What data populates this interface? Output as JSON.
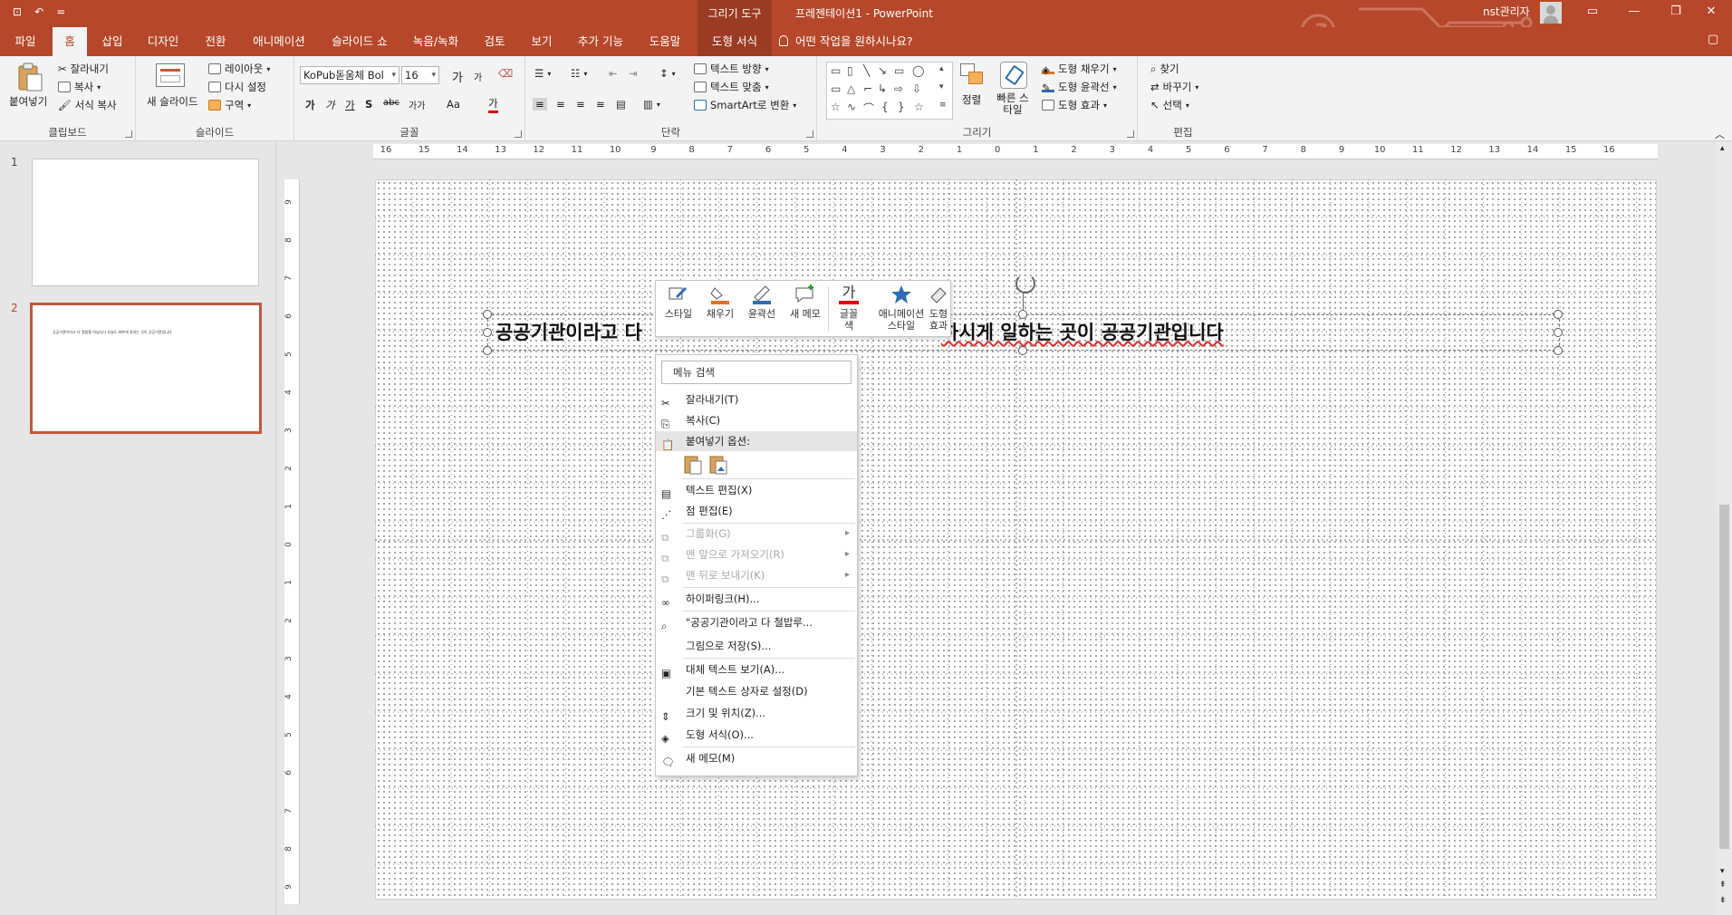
{
  "titlebar": {
    "qat_save": "𝟛",
    "qat_undo": "⟲",
    "qat_more": "≂",
    "tools_tab": "그리기 도구",
    "title": "프레젠테이션1  -  PowerPoint",
    "user": "nst관리자",
    "ribbon_display": "▣",
    "minimize": "—",
    "restore": "❐",
    "close": "✕"
  },
  "tabs": [
    {
      "label": "파일"
    },
    {
      "label": "홈"
    },
    {
      "label": "삽입"
    },
    {
      "label": "디자인"
    },
    {
      "label": "전환"
    },
    {
      "label": "애니메이션"
    },
    {
      "label": "슬라이드 쇼"
    },
    {
      "label": "녹음/녹화"
    },
    {
      "label": "검토"
    },
    {
      "label": "보기"
    },
    {
      "label": "추가 기능"
    },
    {
      "label": "도움말"
    },
    {
      "label": "도형 서식"
    }
  ],
  "tellme": "어떤 작업을 원하시나요?",
  "ribbon": {
    "clipboard": {
      "label": "클립보드",
      "paste": "붙여넣기",
      "cut": "잘라내기",
      "copy": "복사",
      "format_painter": "서식 복사"
    },
    "slides": {
      "label": "슬라이드",
      "new_slide": "새 슬라이드",
      "layout": "레이아웃",
      "reset": "다시 설정",
      "section": "구역"
    },
    "font": {
      "label": "글꼴",
      "font_name": "KoPub돋움체 Bol",
      "font_size": "16",
      "grow": "가",
      "shrink": "가",
      "bold": "가",
      "italic": "가",
      "underline": "가",
      "shadow": "S",
      "strike": "abc",
      "spacing": "가가",
      "case": "Aa",
      "color": "가"
    },
    "paragraph": {
      "label": "단락",
      "text_direction": "텍스트 방향",
      "align_text": "텍스트 맞춤",
      "smartart": "SmartArt로 변환"
    },
    "drawing": {
      "label": "그리기",
      "arrange": "정렬",
      "quick_styles": "빠른 스타일",
      "fill": "도형 채우기",
      "outline": "도형 윤곽선",
      "effects": "도형 효과"
    },
    "editing": {
      "label": "편집",
      "find": "찾기",
      "replace": "바꾸기",
      "select": "선택"
    }
  },
  "slides_pane": [
    {
      "number": "1",
      "text": ""
    },
    {
      "number": "2",
      "text": "공공기관이라고 다 철밥통 아닙니다 오늘도 바쁘게 일하는 곳이 공공기관입니다"
    }
  ],
  "ruler": {
    "h_ticks": [
      "16",
      "15",
      "14",
      "13",
      "12",
      "11",
      "10",
      "9",
      "8",
      "7",
      "6",
      "5",
      "4",
      "3",
      "2",
      "1",
      "0",
      "1",
      "2",
      "3",
      "4",
      "5",
      "6",
      "7",
      "8",
      "9",
      "10",
      "11",
      "12",
      "13",
      "14",
      "15",
      "16"
    ],
    "v_ticks": [
      "9",
      "8",
      "7",
      "6",
      "5",
      "4",
      "3",
      "2",
      "1",
      "0",
      "1",
      "2",
      "3",
      "4",
      "5",
      "6",
      "7",
      "8",
      "9"
    ]
  },
  "slide": {
    "text_left": "공공기관이라고 다",
    "text_right": "하시게 일하는 곳이 공공기관입니다"
  },
  "mini_toolbar": [
    {
      "label": "스타일"
    },
    {
      "label": "채우기"
    },
    {
      "label": "윤곽선"
    },
    {
      "label": "새 메모"
    },
    {
      "label": "글꼴\n색"
    },
    {
      "label": "애니메이션\n스타일"
    },
    {
      "label": "도형\n효과"
    }
  ],
  "context_menu": {
    "search": "메뉴 검색",
    "items": [
      {
        "label": "잘라내기(T)",
        "enabled": true
      },
      {
        "label": "복사(C)",
        "enabled": true
      },
      {
        "label": "붙여넣기 옵션:",
        "enabled": true
      },
      {
        "label": "텍스트 편집(X)",
        "enabled": true
      },
      {
        "label": "점 편집(E)",
        "enabled": true
      },
      {
        "label": "그룹화(G)",
        "enabled": false
      },
      {
        "label": "맨 앞으로 가져오기(R)",
        "enabled": false
      },
      {
        "label": "맨 뒤로 보내기(K)",
        "enabled": false
      },
      {
        "label": "하이퍼링크(H)...",
        "enabled": true
      },
      {
        "label": "\"공공기관이라고 다 철밥루...",
        "enabled": true
      },
      {
        "label": "그림으로 저장(S)...",
        "enabled": true
      },
      {
        "label": "대체 텍스트 보기(A)...",
        "enabled": true
      },
      {
        "label": "기본 텍스트 상자로 설정(D)",
        "enabled": true
      },
      {
        "label": "크기 및 위치(Z)...",
        "enabled": true
      },
      {
        "label": "도형 서식(O)...",
        "enabled": true
      },
      {
        "label": "새 메모(M)",
        "enabled": true
      }
    ]
  },
  "colors": {
    "accent": "#b7472a",
    "context_tab": "#9c3b23",
    "ribbon_bg": "#f3f3f3"
  }
}
